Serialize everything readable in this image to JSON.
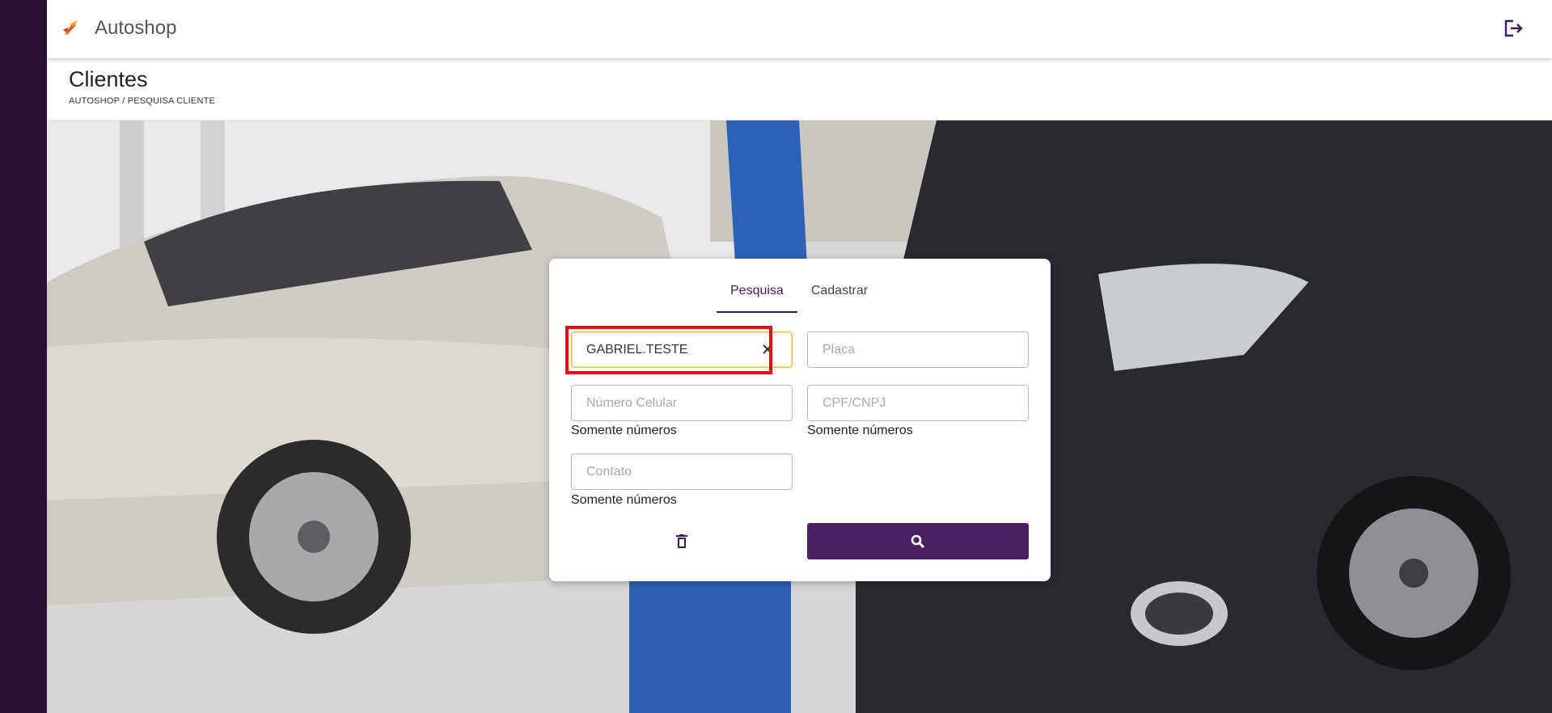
{
  "app": {
    "title": "Autoshop"
  },
  "header": {
    "logout_icon": "logout-icon",
    "logo_icon": "autoshop-logo-icon"
  },
  "page": {
    "title": "Clientes",
    "breadcrumb": "AUTOSHOP / PESQUISA CLIENTE"
  },
  "tabs": [
    {
      "label": "Pesquisa",
      "active": true
    },
    {
      "label": "Cadastrar",
      "active": false
    }
  ],
  "form": {
    "nome": {
      "value": "GABRIEL.TESTE",
      "placeholder": ""
    },
    "placa": {
      "placeholder": "Placa"
    },
    "celular": {
      "placeholder": "Número Celular",
      "hint": "Somente números"
    },
    "cpf": {
      "placeholder": "CPF/CNPJ",
      "hint": "Somente números"
    },
    "contato": {
      "placeholder": "Contato",
      "hint": "Somente números"
    }
  },
  "actions": {
    "clear_icon": "trash-icon",
    "search_icon": "search-icon"
  },
  "colors": {
    "sidebar": "#2a1238",
    "accent": "#4a1f63",
    "highlight": "#e01010"
  }
}
